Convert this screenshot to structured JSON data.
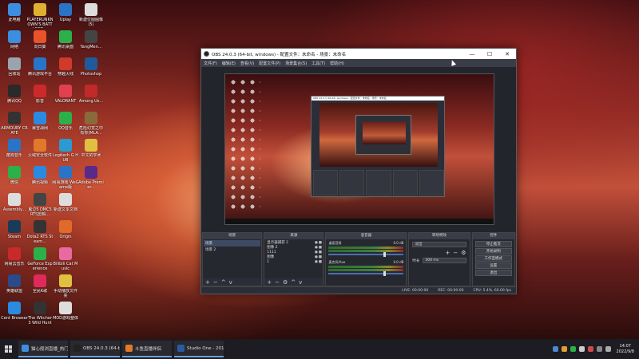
{
  "desktop": {
    "icons": [
      {
        "label": "此电脑",
        "color": "#3b8ee0"
      },
      {
        "label": "PLAYERUNKNOWN'S BATTLEGR...",
        "color": "#e0b030"
      },
      {
        "label": "Uplay",
        "color": "#2a74c8"
      },
      {
        "label": "新建位图图像 (5)",
        "color": "#dddddd"
      },
      {
        "label": "网络",
        "color": "#3b8ee0"
      },
      {
        "label": "向日葵",
        "color": "#e8542a"
      },
      {
        "label": "腾讯桌面",
        "color": "#2bb04a"
      },
      {
        "label": "YangMen...",
        "color": "#444444"
      },
      {
        "label": "回收站",
        "color": "#9aa4ae"
      },
      {
        "label": "腾讯游戏平台",
        "color": "#2a74c8"
      },
      {
        "label": "穿越火线",
        "color": "#d03a2a"
      },
      {
        "label": "Photoshop",
        "color": "#1f5b9a"
      },
      {
        "label": "腾讯QQ",
        "color": "#2a2a2a"
      },
      {
        "label": "影音",
        "color": "#cc2a2a"
      },
      {
        "label": "VALORANT",
        "color": "#e04050"
      },
      {
        "label": "Among.Us...",
        "color": "#c02a2a"
      },
      {
        "label": "ARMOURY CRATE",
        "color": "#333333"
      },
      {
        "label": "暴雪战网",
        "color": "#2a8ae0"
      },
      {
        "label": "QQ音乐",
        "color": "#2bb04a"
      },
      {
        "label": "危险幻觉之中有你(MLA...",
        "color": "#8a6a3a"
      },
      {
        "label": "酷狗音乐",
        "color": "#2a74c8"
      },
      {
        "label": "火绒安全软件",
        "color": "#e07a2a"
      },
      {
        "label": "Logitech G HUB",
        "color": "#2a9ad0"
      },
      {
        "label": "中文的学术",
        "color": "#e0c040"
      },
      {
        "label": "微信",
        "color": "#2bb04a"
      },
      {
        "label": "腾讯视频",
        "color": "#2a8ae0"
      },
      {
        "label": "网易游戏 WeGame版",
        "color": "#2a74c8"
      },
      {
        "label": "Adobe Premier...",
        "color": "#5a2a8a"
      },
      {
        "label": "Assembly...",
        "color": "#dddddd"
      },
      {
        "label": "鬼泣5 DMC5 RTS剪辑...",
        "color": "#444444"
      },
      {
        "label": "新建文本文档",
        "color": "#dddddd"
      },
      {
        "label": "",
        "color": "#000000"
      },
      {
        "label": "Steam",
        "color": "#1a3a5a"
      },
      {
        "label": "Dota2 RTS Steam...",
        "color": "#333333"
      },
      {
        "label": "Origin",
        "color": "#e06a2a"
      },
      {
        "label": "",
        "color": "#000000"
      },
      {
        "label": "网易云音乐",
        "color": "#c82a2a"
      },
      {
        "label": "GeForce Experience",
        "color": "#2bb04a"
      },
      {
        "label": "Bilibili Cat Music",
        "color": "#e86aa0"
      },
      {
        "label": "",
        "color": "#000000"
      },
      {
        "label": "英雄联盟",
        "color": "#2a4a8a"
      },
      {
        "label": "全民K歌",
        "color": "#e02a5a"
      },
      {
        "label": "手动播放文件夹",
        "color": "#e0c040"
      },
      {
        "label": "",
        "color": "#000000"
      },
      {
        "label": "Cent Browser",
        "color": "#2a8ae0"
      },
      {
        "label": "The Witcher 3 Wild Hunt",
        "color": "#333333"
      },
      {
        "label": "MOD游戏整体",
        "color": "#dddddd"
      },
      {
        "label": "",
        "color": "#000000"
      }
    ]
  },
  "obs": {
    "title": "OBS 24.0.3 (64-bit, windows) - 配置文件：未命名 - 场景：未命名",
    "window_buttons": [
      "—",
      "☐",
      "✕"
    ],
    "menu": [
      "文件(F)",
      "编辑(E)",
      "查看(V)",
      "配置文件(P)",
      "场景集合(S)",
      "工具(T)",
      "帮助(H)"
    ],
    "nested_title": "OBS 24.0.3 (64-bit, windows) - 配置文件：未命名 - 场景：未命名",
    "docks": {
      "scenes": {
        "header": "场景",
        "items": [
          "场景",
          "场景 2"
        ],
        "active_index": 0
      },
      "sources": {
        "header": "来源",
        "items": [
          "显示器捕获 2",
          "图像 2",
          "1111",
          "图像",
          "1"
        ]
      },
      "mixer": {
        "header": "混音器",
        "channels": [
          {
            "name": "桌面音频",
            "db": "0.0 dB"
          },
          {
            "name": "麦克风/Aux",
            "db": "0.0 dB"
          }
        ]
      },
      "transitions": {
        "header": "转场特效",
        "selected": "淡出",
        "duration_label": "时长",
        "duration_value": "300 ms"
      },
      "controls": {
        "header": "控件",
        "buttons": [
          "停止推流",
          "开始录制",
          "工作室模式",
          "设置",
          "退出"
        ]
      }
    },
    "status": {
      "live": "LIVE: 00:00:00",
      "rec": "REC: 00:00:00",
      "cpu": "CPU: 5.4%, 60.00 fps"
    }
  },
  "taskbar": {
    "tasks": [
      {
        "label": "猫心般浏直播_热门...",
        "color": "#3b8ee0"
      },
      {
        "label": "OBS 24.0.3 (64-bit...",
        "color": "#222222"
      },
      {
        "label": "斗鱼直播伴侣",
        "color": "#e07a2a"
      },
      {
        "label": "Studio One - 2013...",
        "color": "#2a5aa0"
      }
    ],
    "clock_time": "14:07",
    "clock_date": "2022/9/8"
  }
}
